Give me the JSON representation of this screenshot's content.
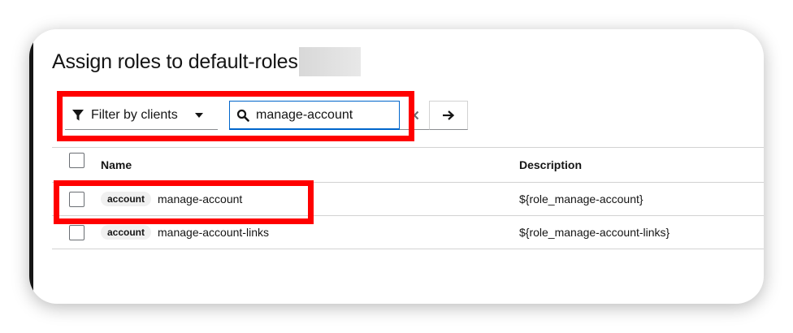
{
  "modal": {
    "title": "Assign roles to default-roles"
  },
  "toolbar": {
    "filter_label": "Filter by clients",
    "search_value": "manage-account"
  },
  "table": {
    "columns": [
      "Name",
      "Description"
    ],
    "rows": [
      {
        "badge": "account",
        "name": "manage-account",
        "description": "${role_manage-account}"
      },
      {
        "badge": "account",
        "name": "manage-account-links",
        "description": "${role_manage-account-links}"
      }
    ]
  },
  "colors": {
    "highlight": "#ff0000",
    "focus": "#0066cc"
  },
  "icons": [
    "filter-icon",
    "caret-down-icon",
    "search-icon",
    "close-icon",
    "arrow-right-icon"
  ]
}
